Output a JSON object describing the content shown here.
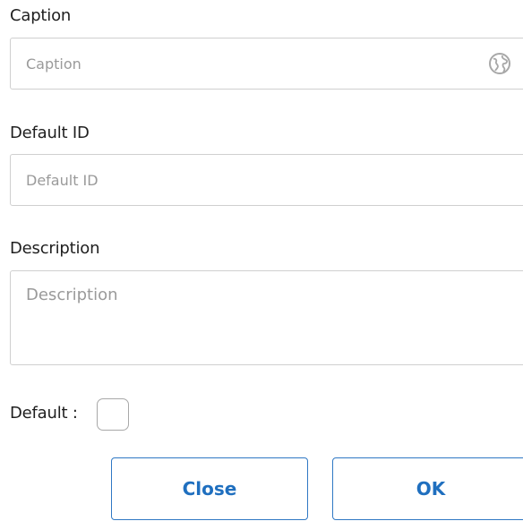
{
  "form": {
    "caption": {
      "label": "Caption",
      "placeholder": "Caption",
      "value": ""
    },
    "default_id": {
      "label": "Default ID",
      "placeholder": "Default ID",
      "value": ""
    },
    "description": {
      "label": "Description",
      "placeholder": "Description",
      "value": ""
    },
    "default": {
      "label": "Default :",
      "checked": false
    }
  },
  "buttons": {
    "close_label": "Close",
    "ok_label": "OK"
  },
  "icons": {
    "caption_globe": "globe-icon"
  },
  "colors": {
    "accent": "#1f6fbf",
    "border": "#cfcfcf",
    "placeholder": "#9a9a9a"
  }
}
